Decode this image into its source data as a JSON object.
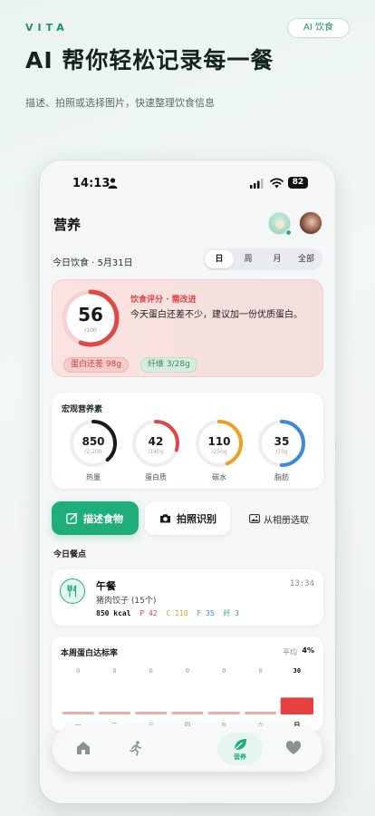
{
  "hero": {
    "brand": "VITA",
    "badge": "AI 饮食",
    "headline": "AI 帮你轻松记录每一餐",
    "subline": "描述、拍照或选择图片，快速整理饮食信息"
  },
  "status_bar": {
    "time": "14:13",
    "battery": "82"
  },
  "nav": {
    "title": "营养"
  },
  "date": {
    "label": "今日饮食 · 5月31日",
    "segments": [
      "日",
      "周",
      "月",
      "全部"
    ],
    "active": "日"
  },
  "score": {
    "value": "56",
    "max": "/100",
    "fraction": 0.56,
    "title": "饮食评分 · 需改进",
    "description": "今天蛋白还差不少，建议加一份优质蛋白。",
    "chip_protein": "蛋白还差 98g",
    "chip_fiber": "纤维 3/28g",
    "color": "#e04848"
  },
  "macros": {
    "title": "宏观营养素",
    "items": [
      {
        "value": "850",
        "target": "/2,200",
        "name": "热量",
        "fraction": 0.386,
        "color": "#1a1a1a"
      },
      {
        "value": "42",
        "target": "/140g",
        "name": "蛋白质",
        "fraction": 0.3,
        "color": "#e04848"
      },
      {
        "value": "110",
        "target": "/250g",
        "name": "碳水",
        "fraction": 0.44,
        "color": "#f0a020"
      },
      {
        "value": "35",
        "target": "/70g",
        "name": "脂肪",
        "fraction": 0.5,
        "color": "#3a8be0"
      }
    ]
  },
  "actions": {
    "describe": "描述食物",
    "photo": "拍照识别",
    "album": "从相册选取"
  },
  "meals": {
    "section_title": "今日餐点",
    "items": [
      {
        "name": "午餐",
        "time": "13:34",
        "food": "猪肉饺子 (15个)",
        "kcal": "850 kcal",
        "protein": "P 42",
        "carbs": "C 110",
        "fat": "F 35",
        "fiber": "纤 3"
      }
    ]
  },
  "weekly": {
    "title": "本周蛋白达标率",
    "avg_label": "平均",
    "avg_value": "4%"
  },
  "chart_data": {
    "type": "bar",
    "title": "本周蛋白达标率",
    "categories": [
      "一",
      "二",
      "三",
      "四",
      "五",
      "六",
      "日"
    ],
    "values": [
      0,
      0,
      0,
      0,
      0,
      0,
      30
    ],
    "value_labels": [
      "0",
      "0",
      "0",
      "0",
      "0",
      "0",
      "30"
    ],
    "ylim": [
      0,
      100
    ],
    "highlight_index": 6,
    "bar_color": "#f2aaa8",
    "highlight_color": "#e64040"
  },
  "tabbar": {
    "items": [
      {
        "icon": "home-icon"
      },
      {
        "icon": "run-icon"
      },
      {
        "icon": "moon-icon"
      },
      {
        "icon": "leaf-icon",
        "label": "营养"
      },
      {
        "icon": "heart-icon"
      }
    ],
    "accent": "#1fae7a"
  }
}
